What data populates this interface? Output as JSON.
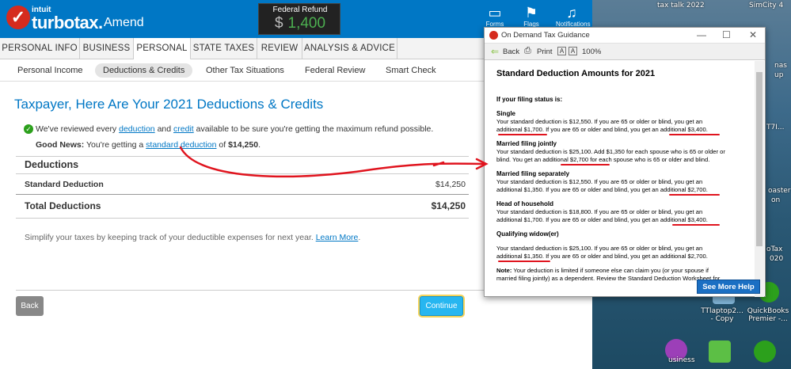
{
  "desktop": {
    "top_labels": [
      "tax talk 2022",
      "SimCity 4"
    ],
    "right_labels": [
      "nas",
      "up",
      "T7I...",
      "oaster",
      "on",
      "oTax",
      "020",
      "QuickBooks Premier -..."
    ],
    "icon_labels": [
      "TTlaptop2... - Copy",
      "usiness"
    ]
  },
  "tt": {
    "logo_intuit": "intuit",
    "logo_brand": "turbotax.",
    "logo_amend": "Amend",
    "refund_label": "Federal Refund",
    "refund_currency": "$",
    "refund_amount": "1,400",
    "header_icons": [
      {
        "label": "Forms",
        "icon": "forms-icon"
      },
      {
        "label": "Flags",
        "icon": "flag-icon"
      },
      {
        "label": "Notifications",
        "icon": "bell-icon"
      }
    ],
    "nav1": [
      "PERSONAL INFO",
      "BUSINESS",
      "PERSONAL",
      "STATE TAXES",
      "REVIEW",
      "ANALYSIS & ADVICE"
    ],
    "nav1_active": "PERSONAL",
    "nav2": [
      "Personal Income",
      "Deductions & Credits",
      "Other Tax Situations",
      "Federal Review",
      "Smart Check"
    ],
    "nav2_active": "Deductions & Credits",
    "title": "Taxpayer, Here Are Your 2021 Deductions & Credits",
    "review": {
      "pre": "We've reviewed every ",
      "link1": "deduction",
      "mid": " and ",
      "link2": "credit",
      "post": " available to be sure you're getting the maximum refund possible."
    },
    "good_news": {
      "bold": "Good News:",
      "pre": " You're getting a ",
      "link": "standard deduction",
      "mid": " of ",
      "amount": "$14,250",
      "post": "."
    },
    "deductions_heading": "Deductions",
    "standard_deduction_label": "Standard Deduction",
    "standard_deduction_value": "$14,250",
    "total_label": "Total Deductions",
    "total_value": "$14,250",
    "simplify_text": "Simplify your taxes by keeping track of your deductible expenses for next year. ",
    "learn_more": "Learn More",
    "learn_more_tail": ".",
    "back_button": "Back",
    "continue_button": "Continue"
  },
  "dlg": {
    "title": "On Demand Tax Guidance",
    "back": "Back",
    "print": "Print",
    "zoom_small": "A",
    "zoom_large": "A",
    "zoom": "100%",
    "heading": "Standard Deduction Amounts for 2021",
    "lead": "If your filing status is:",
    "statuses": [
      {
        "name": "Single",
        "lines": [
          "Your standard deduction is $12,550. If you are 65 or older or blind, you get an",
          "additional $1,700. If you are 65 or older and blind, you get an additional $3,400."
        ]
      },
      {
        "name": "Married filing jointly",
        "lines": [
          "Your standard deduction is $25,100. Add $1,350 for each spouse who is 65 or older or",
          "blind. You get an additional $2,700 for each spouse who is 65 or older and blind."
        ]
      },
      {
        "name": "Married filing separately",
        "lines": [
          "Your standard deduction is $12,550. If you are 65 or older or blind, you get an",
          "additional $1,350. If you are 65 or older and blind, you get an additional $2,700."
        ]
      },
      {
        "name": "Head of household",
        "lines": [
          "Your standard deduction is $18,800. If you are 65 or older or blind, you get an",
          "additional $1,700. If you are 65 or older and blind, you get an additional $3,400."
        ]
      },
      {
        "name": "Qualifying widow(er)",
        "lines": [
          "Your standard deduction is $25,100. If you are 65 or older or blind, you get an",
          "additional $1,350. If you are 65 or older and blind, you get an additional $2,700."
        ]
      }
    ],
    "note_bold": "Note:",
    "note_text": " Your deduction is limited if someone else can claim you (or your spouse if",
    "note_text2": "married filing jointly) as a dependent. Review the Standard Deduction Worksheet for",
    "see_more": "See More Help"
  },
  "colors": {
    "brand_blue": "#0077c5",
    "refund_green": "#4caf50",
    "annotation_red": "#e0141e",
    "continue_blue": "#27b6f0"
  }
}
